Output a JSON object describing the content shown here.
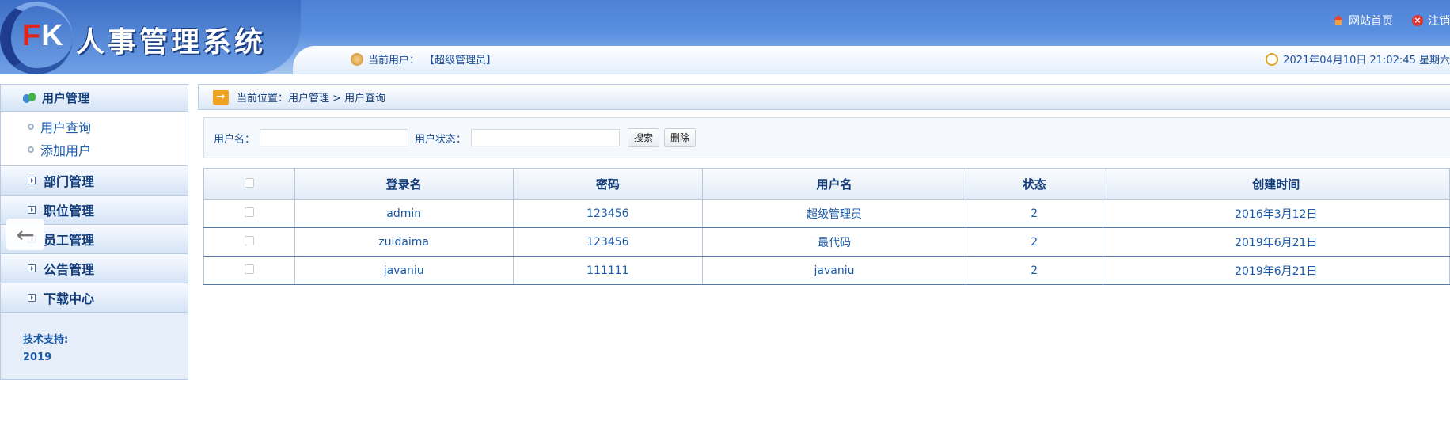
{
  "header": {
    "logo_f": "F",
    "logo_k": "K",
    "title": "人事管理系统",
    "home_link": "网站首页",
    "logout_link": "注销",
    "current_user_label": "当前用户：",
    "current_user_value": "【超级管理员】",
    "datetime": "2021年04月10日 21:02:45 星期六"
  },
  "sidebar": {
    "section_title": "用户管理",
    "sub_items": [
      {
        "label": "用户查询"
      },
      {
        "label": "添加用户"
      }
    ],
    "menus": [
      {
        "label": "部门管理"
      },
      {
        "label": "职位管理"
      },
      {
        "label": "员工管理"
      },
      {
        "label": "公告管理"
      },
      {
        "label": "下载中心"
      }
    ],
    "support_label": "技术支持:",
    "support_year": "2019"
  },
  "breadcrumb": {
    "prefix": "当前位置：",
    "path": "用户管理 > 用户查询"
  },
  "search": {
    "username_label": "用户名：",
    "username_value": "",
    "status_label": "用户状态：",
    "status_value": "",
    "search_button": "搜索",
    "delete_button": "删除"
  },
  "table": {
    "headers": [
      "登录名",
      "密码",
      "用户名",
      "状态",
      "创建时间"
    ],
    "rows": [
      {
        "login": "admin",
        "password": "123456",
        "name": "超级管理员",
        "status": "2",
        "created": "2016年3月12日"
      },
      {
        "login": "zuidaima",
        "password": "123456",
        "name": "最代码",
        "status": "2",
        "created": "2019年6月21日"
      },
      {
        "login": "javaniu",
        "password": "111111",
        "name": "javaniu",
        "status": "2",
        "created": "2019年6月21日"
      }
    ]
  },
  "icons": {
    "back": "arrow-left-icon",
    "home": "home-icon",
    "logout": "logout-icon",
    "user": "user-icon",
    "clock": "clock-icon"
  },
  "colors": {
    "header_blue": "#4d82d6",
    "text_blue": "#1a5aa8",
    "logo_red": "#e1251b"
  }
}
